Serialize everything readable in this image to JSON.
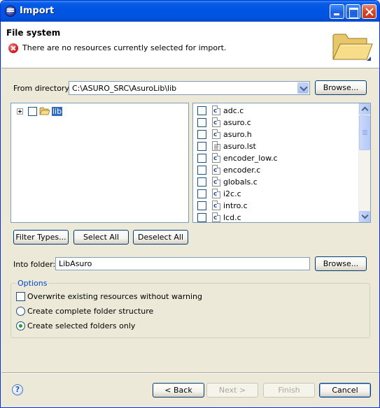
{
  "window": {
    "title": "Import"
  },
  "header": {
    "title": "File system",
    "message": "There are no resources currently selected for import."
  },
  "from_directory": {
    "label": "From directory:",
    "value": "C:\\ASURO_SRC\\AsuroLib\\lib",
    "browse_label": "Browse..."
  },
  "tree": {
    "root": {
      "label": "lib",
      "checked": false,
      "expanded": false
    }
  },
  "files": [
    {
      "name": "adc.c",
      "type": "c-file-icon"
    },
    {
      "name": "asuro.c",
      "type": "c-file-icon"
    },
    {
      "name": "asuro.h",
      "type": "c-file-icon"
    },
    {
      "name": "asuro.lst",
      "type": "text-file-icon"
    },
    {
      "name": "encoder_low.c",
      "type": "c-file-icon"
    },
    {
      "name": "encoder.c",
      "type": "c-file-icon"
    },
    {
      "name": "globals.c",
      "type": "c-file-icon"
    },
    {
      "name": "i2c.c",
      "type": "c-file-icon"
    },
    {
      "name": "intro.c",
      "type": "c-file-icon"
    },
    {
      "name": "lcd.c",
      "type": "c-file-icon"
    }
  ],
  "selection_buttons": {
    "filter_types": "Filter Types...",
    "select_all": "Select All",
    "deselect_all": "Deselect All"
  },
  "into_folder": {
    "label": "Into folder:",
    "value": "LibAsuro",
    "browse_label": "Browse..."
  },
  "options": {
    "group_label": "Options",
    "overwrite": {
      "label": "Overwrite existing resources without warning",
      "checked": false
    },
    "create_complete": {
      "label": "Create complete folder structure",
      "selected": false
    },
    "create_selected": {
      "label": "Create selected folders only",
      "selected": true
    }
  },
  "footer": {
    "help_glyph": "?",
    "back": "< Back",
    "next": "Next >",
    "finish": "Finish",
    "cancel": "Cancel"
  },
  "colors": {
    "titlebar": "#0054e3",
    "selection": "#316ac5",
    "options_label": "#0046d5"
  }
}
